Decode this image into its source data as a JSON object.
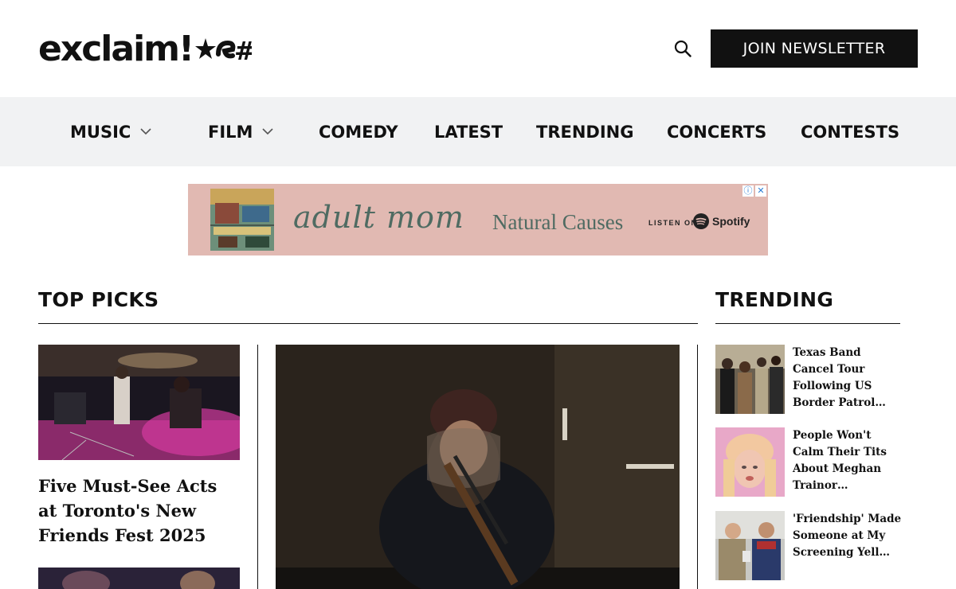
{
  "header": {
    "logo_text": "exclaim!",
    "join_label": "JOIN NEWSLETTER"
  },
  "nav": {
    "items": [
      {
        "label": "MUSIC",
        "has_dropdown": true
      },
      {
        "label": "FILM",
        "has_dropdown": true
      },
      {
        "label": "COMEDY",
        "has_dropdown": false
      },
      {
        "label": "LATEST",
        "has_dropdown": false
      },
      {
        "label": "TRENDING",
        "has_dropdown": false
      },
      {
        "label": "CONCERTS",
        "has_dropdown": false
      },
      {
        "label": "CONTESTS",
        "has_dropdown": false
      }
    ]
  },
  "ad": {
    "brand": "adult mom",
    "album": "Natural Causes",
    "listen_on": "LISTEN ON",
    "platform": "Spotify",
    "info_icon": "info-icon",
    "close_icon": "close-icon"
  },
  "top_picks": {
    "title": "TOP PICKS",
    "cards": [
      {
        "title": "Five Must-See Acts at Toronto's New Friends Fest 2025",
        "image": "concert-stage-photo"
      },
      {
        "title": "",
        "image": "concert-photo-partial"
      }
    ],
    "feature": {
      "image": "film-still-child-with-rifle"
    }
  },
  "trending": {
    "title": "TRENDING",
    "items": [
      {
        "title": "Texas Band Cancel Tour Following US Border Patrol…",
        "image": "band-photo"
      },
      {
        "title": "People Won't Calm Their Tits About Meghan Trainor…",
        "image": "meghan-trainor-photo"
      },
      {
        "title": "'Friendship' Made Someone at My Screening Yell…",
        "image": "friendship-film-still"
      }
    ]
  },
  "colors": {
    "nav_bg": "#f1f2f3",
    "ad_bg": "#e1b9b2",
    "button_bg": "#111111"
  }
}
